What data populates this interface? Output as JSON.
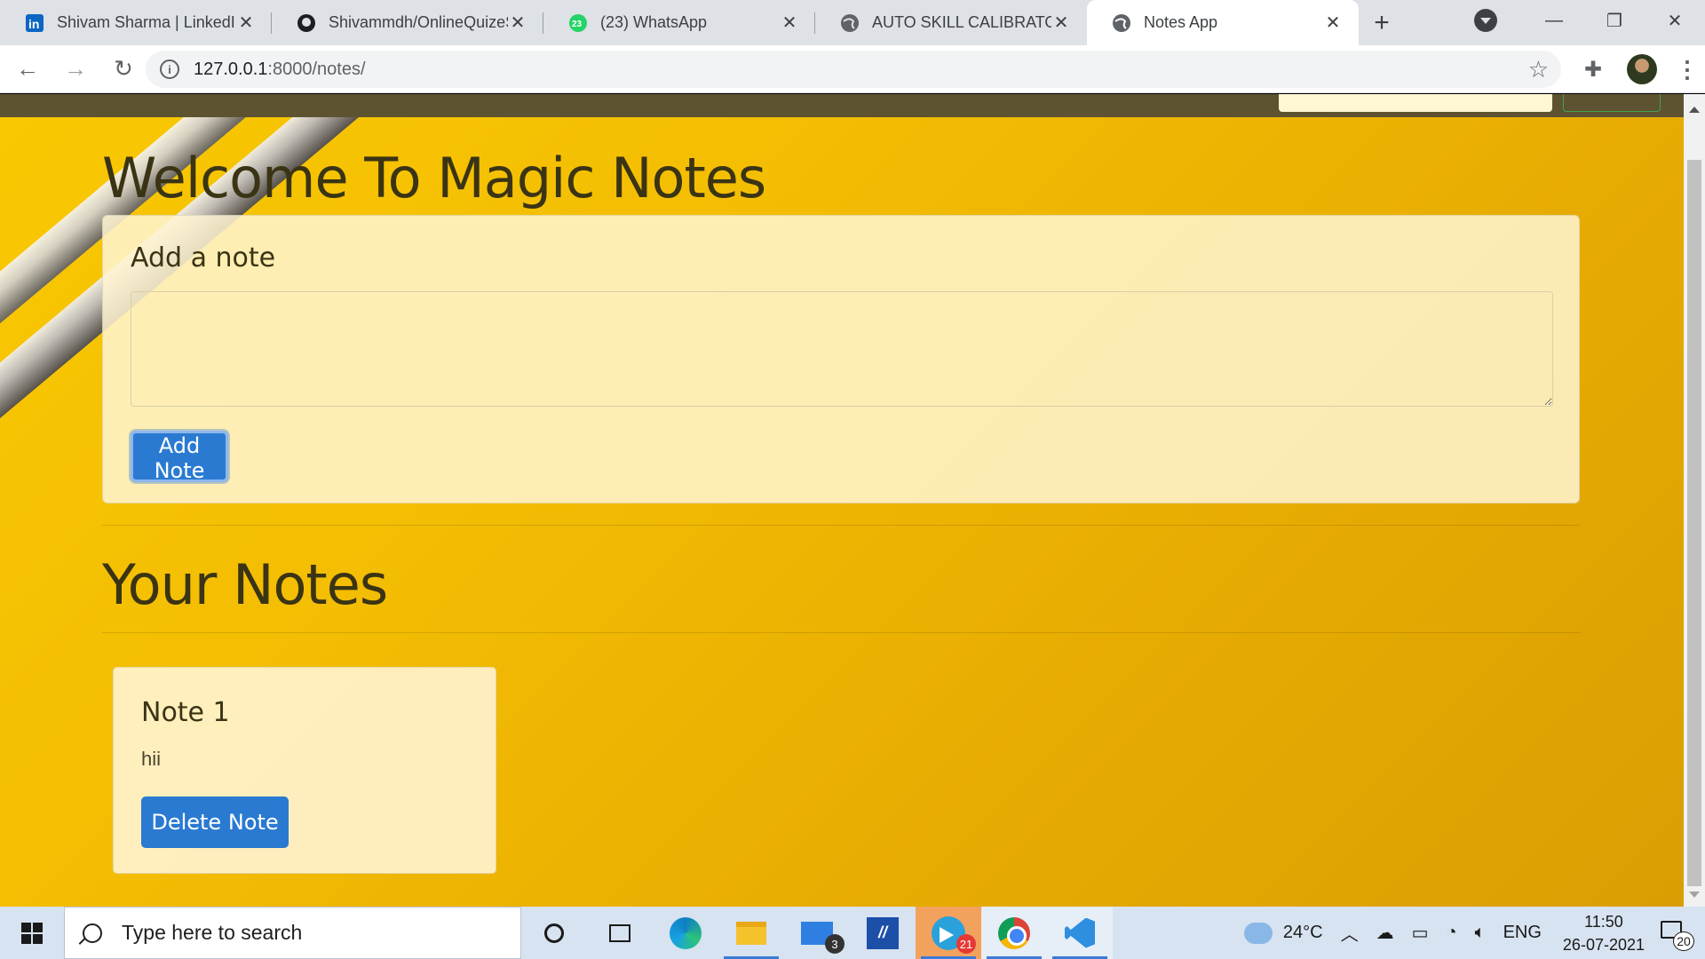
{
  "browser": {
    "tabs": [
      {
        "title": "Shivam Sharma | LinkedIn",
        "icon": "linkedin-icon",
        "active": false
      },
      {
        "title": "Shivammdh/OnlineQuizeS",
        "icon": "github-icon",
        "active": false
      },
      {
        "title": "(23) WhatsApp",
        "icon": "whatsapp-icon",
        "badge": "23",
        "active": false
      },
      {
        "title": "AUTO SKILL CALIBRATOR",
        "icon": "globe-icon",
        "active": false
      },
      {
        "title": "Notes App",
        "icon": "globe-icon",
        "active": true
      }
    ],
    "url_host": "127.0.0.1",
    "url_rest": ":8000/notes/"
  },
  "page": {
    "heading": "Welcome To Magic Notes",
    "add_card": {
      "title": "Add a note",
      "textarea_value": "",
      "button_label": "Add Note"
    },
    "notes_heading": "Your Notes",
    "notes": [
      {
        "title": "Note 1",
        "text": "hii",
        "button_label": "Delete Note"
      }
    ]
  },
  "taskbar": {
    "search_placeholder": "Type here to search",
    "mail_badge": "3",
    "telegram_badge": "21",
    "temperature": "24°C",
    "language": "ENG",
    "time": "11:50",
    "date": "26-07-2021",
    "notification_count": "20"
  },
  "colors": {
    "page_bg": "#f3bd03",
    "card_bg": "#fff4d2",
    "primary_button": "#2a7ad2",
    "navbar": "#5d5331"
  }
}
